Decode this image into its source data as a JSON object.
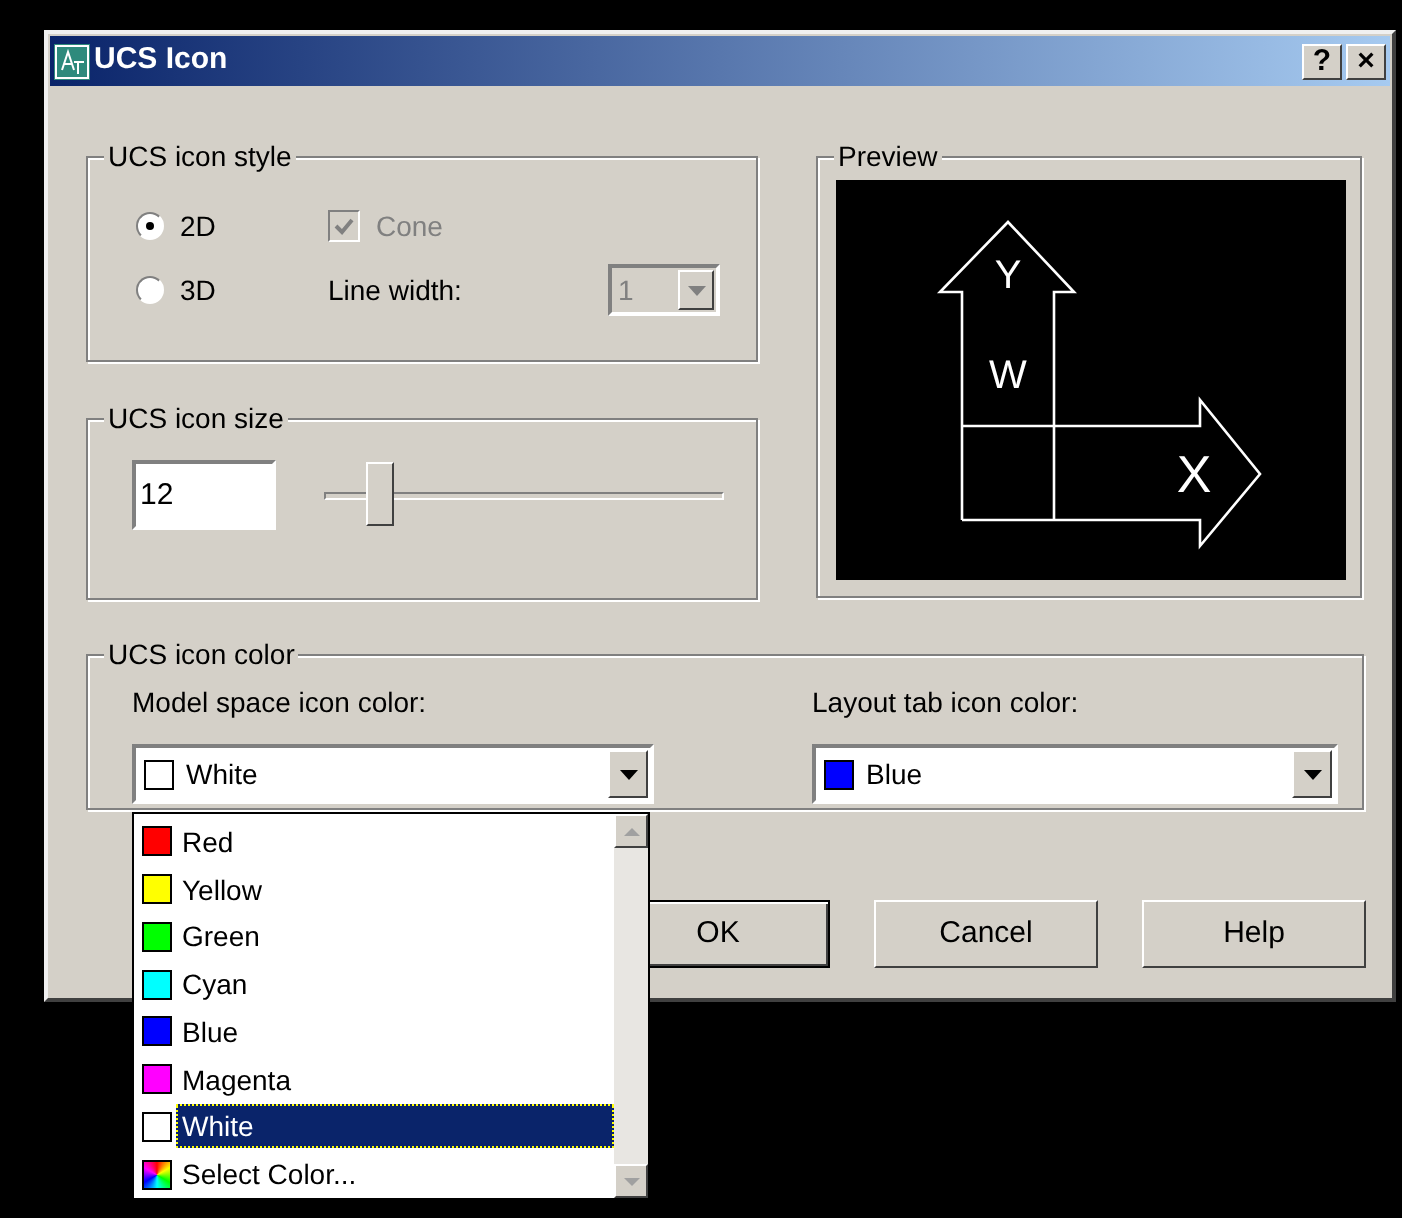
{
  "window": {
    "title": "UCS Icon",
    "buttons": [
      "?",
      "×"
    ]
  },
  "style_group": {
    "title": "UCS icon style",
    "options": [
      {
        "label": "2D",
        "selected": true
      },
      {
        "label": "3D",
        "selected": false
      }
    ],
    "cone": {
      "label": "Cone",
      "checked": true,
      "disabled": true
    },
    "line_width": {
      "label": "Line width:",
      "value": "1",
      "disabled": true
    }
  },
  "preview": {
    "title": "Preview",
    "axis_labels": [
      "Y",
      "W",
      "X"
    ]
  },
  "size_group": {
    "title": "UCS icon size",
    "value": "12",
    "slider": {
      "level": 0.11
    }
  },
  "color_group": {
    "title": "UCS icon color",
    "model_space": {
      "label": "Model space icon color:",
      "value": "White",
      "color": "#ffffff"
    },
    "layout_tab": {
      "label": "Layout tab icon color:",
      "value": "Blue",
      "color": "#0000ff"
    }
  },
  "dropdown_list": {
    "items": [
      {
        "kind": "color",
        "label": "Red",
        "color": "#ff0000",
        "selected": false
      },
      {
        "kind": "color",
        "label": "Yellow",
        "color": "#ffff00",
        "selected": false
      },
      {
        "kind": "color",
        "label": "Green",
        "color": "#00ff00",
        "selected": false
      },
      {
        "kind": "color",
        "label": "Cyan",
        "color": "#00ffff",
        "selected": false
      },
      {
        "kind": "color",
        "label": "Blue",
        "color": "#0000ff",
        "selected": false
      },
      {
        "kind": "color",
        "label": "Magenta",
        "color": "#ff00ff",
        "selected": false
      },
      {
        "kind": "color",
        "label": "White",
        "color": "#ffffff",
        "selected": true
      },
      {
        "kind": "picker",
        "label": "Select Color...",
        "selected": false
      }
    ]
  },
  "buttons": [
    {
      "label": "OK",
      "default": true
    },
    {
      "label": "Cancel",
      "default": false
    },
    {
      "label": "Help",
      "default": false
    }
  ]
}
